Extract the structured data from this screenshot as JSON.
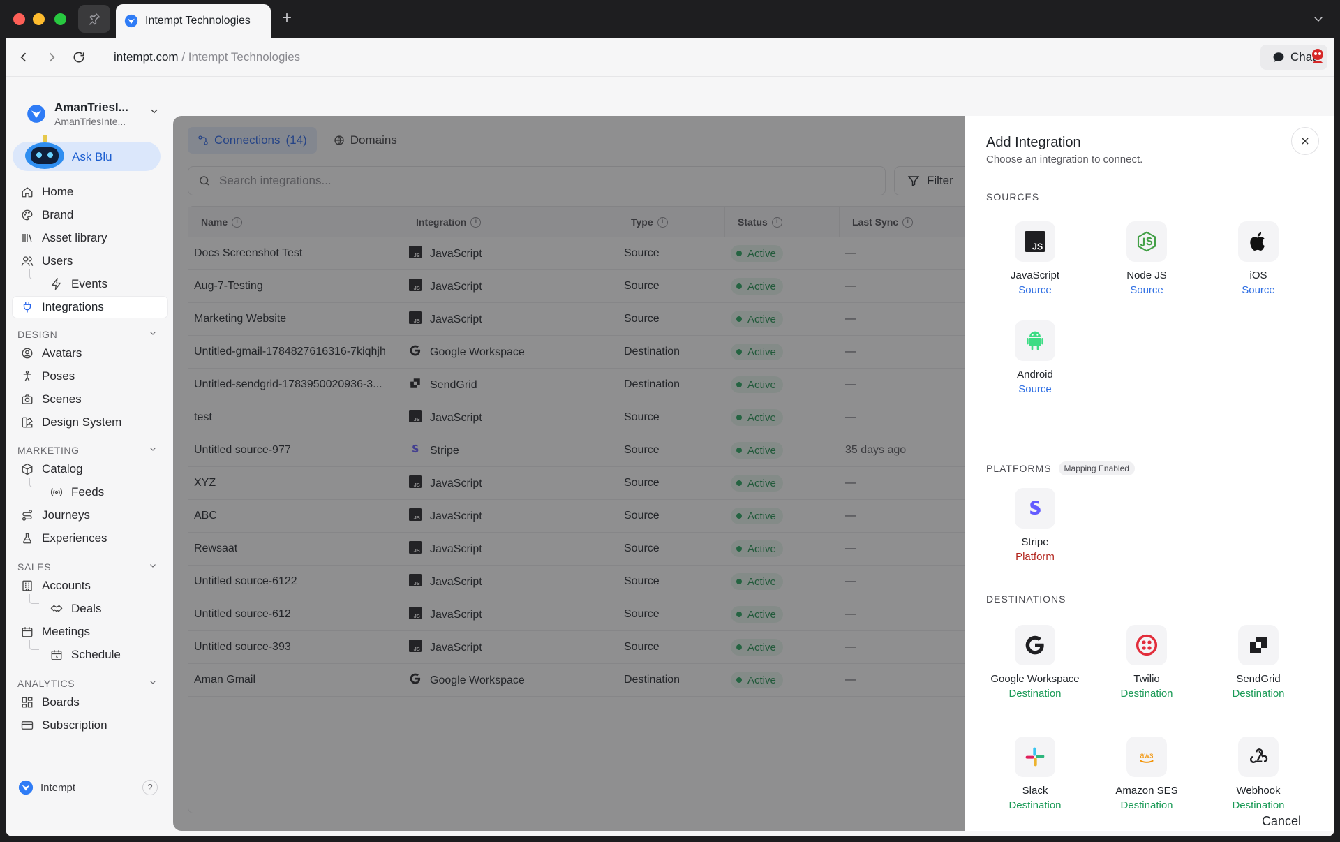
{
  "browser": {
    "tab_title": "Intempt Technologies",
    "url_domain": "intempt.com",
    "url_separator": "/",
    "url_page": "Intempt Technologies",
    "chat_label": "Chat"
  },
  "sidebar": {
    "workspace_name": "AmanTriesI...",
    "workspace_sub": "AmanTriesInte...",
    "ask_blu": "Ask Blu",
    "items": [
      {
        "label": "Home",
        "icon": "home-icon"
      },
      {
        "label": "Brand",
        "icon": "palette-icon"
      },
      {
        "label": "Asset library",
        "icon": "library-icon"
      },
      {
        "label": "Users",
        "icon": "users-icon"
      },
      {
        "label": "Events",
        "icon": "bolt-icon"
      },
      {
        "label": "Integrations",
        "icon": "plug-icon"
      }
    ],
    "sections": [
      {
        "title": "DESIGN",
        "items": [
          {
            "label": "Avatars",
            "icon": "avatar-icon"
          },
          {
            "label": "Poses",
            "icon": "pose-icon"
          },
          {
            "label": "Scenes",
            "icon": "camera-icon"
          },
          {
            "label": "Design System",
            "icon": "design-system-icon"
          }
        ]
      },
      {
        "title": "MARKETING",
        "items": [
          {
            "label": "Catalog",
            "icon": "box-icon"
          },
          {
            "label": "Feeds",
            "icon": "broadcast-icon"
          },
          {
            "label": "Journeys",
            "icon": "route-icon"
          },
          {
            "label": "Experiences",
            "icon": "flask-icon"
          }
        ]
      },
      {
        "title": "SALES",
        "items": [
          {
            "label": "Accounts",
            "icon": "building-icon"
          },
          {
            "label": "Deals",
            "icon": "handshake-icon"
          },
          {
            "label": "Meetings",
            "icon": "calendar-icon"
          },
          {
            "label": "Schedule",
            "icon": "calendar-clock-icon"
          }
        ]
      },
      {
        "title": "ANALYTICS",
        "items": [
          {
            "label": "Boards",
            "icon": "grid-icon"
          },
          {
            "label": "Subscription",
            "icon": "card-icon"
          }
        ]
      }
    ],
    "footer_brand": "Intempt",
    "footer_help": "?"
  },
  "main": {
    "tab_connections": "Connections",
    "tab_connections_count": "(14)",
    "tab_domains": "Domains",
    "search_placeholder": "Search integrations...",
    "filter_label": "Filter",
    "columns": [
      "Name",
      "Integration",
      "Type",
      "Status",
      "Last Sync"
    ],
    "rows": [
      {
        "name": "Docs Screenshot Test",
        "integration": "JavaScript",
        "icon": "js",
        "type": "Source",
        "status": "Active",
        "last_sync": "—"
      },
      {
        "name": "Aug-7-Testing",
        "integration": "JavaScript",
        "icon": "js",
        "type": "Source",
        "status": "Active",
        "last_sync": "—"
      },
      {
        "name": "Marketing Website",
        "integration": "JavaScript",
        "icon": "js",
        "type": "Source",
        "status": "Active",
        "last_sync": "—"
      },
      {
        "name": "Untitled-gmail-1784827616316-7kiqhjh",
        "integration": "Google Workspace",
        "icon": "google",
        "type": "Destination",
        "status": "Active",
        "last_sync": "—"
      },
      {
        "name": "Untitled-sendgrid-1783950020936-3...",
        "integration": "SendGrid",
        "icon": "sendgrid",
        "type": "Destination",
        "status": "Active",
        "last_sync": "—"
      },
      {
        "name": "test",
        "integration": "JavaScript",
        "icon": "js",
        "type": "Source",
        "status": "Active",
        "last_sync": "—"
      },
      {
        "name": "Untitled source-977",
        "integration": "Stripe",
        "icon": "stripe",
        "type": "Source",
        "status": "Active",
        "last_sync": "35 days ago"
      },
      {
        "name": "XYZ",
        "integration": "JavaScript",
        "icon": "js",
        "type": "Source",
        "status": "Active",
        "last_sync": "—"
      },
      {
        "name": "ABC",
        "integration": "JavaScript",
        "icon": "js",
        "type": "Source",
        "status": "Active",
        "last_sync": "—"
      },
      {
        "name": "Rewsaat",
        "integration": "JavaScript",
        "icon": "js",
        "type": "Source",
        "status": "Active",
        "last_sync": "—"
      },
      {
        "name": "Untitled source-6122",
        "integration": "JavaScript",
        "icon": "js",
        "type": "Source",
        "status": "Active",
        "last_sync": "—"
      },
      {
        "name": "Untitled source-612",
        "integration": "JavaScript",
        "icon": "js",
        "type": "Source",
        "status": "Active",
        "last_sync": "—"
      },
      {
        "name": "Untitled source-393",
        "integration": "JavaScript",
        "icon": "js",
        "type": "Source",
        "status": "Active",
        "last_sync": "—"
      },
      {
        "name": "Aman Gmail",
        "integration": "Google Workspace",
        "icon": "google",
        "type": "Destination",
        "status": "Active",
        "last_sync": "—"
      }
    ]
  },
  "drawer": {
    "title": "Add Integration",
    "subtitle": "Choose an integration to connect.",
    "sources_title": "SOURCES",
    "sources": [
      {
        "name": "JavaScript",
        "type": "Source",
        "icon": "js"
      },
      {
        "name": "Node JS",
        "type": "Source",
        "icon": "nodejs"
      },
      {
        "name": "iOS",
        "type": "Source",
        "icon": "apple"
      },
      {
        "name": "Android",
        "type": "Source",
        "icon": "android"
      }
    ],
    "platforms_title": "PLATFORMS",
    "platforms_chip": "Mapping Enabled",
    "platforms": [
      {
        "name": "Stripe",
        "type": "Platform",
        "icon": "stripe"
      }
    ],
    "destinations_title": "DESTINATIONS",
    "destinations": [
      {
        "name": "Google Workspace",
        "type": "Destination",
        "icon": "google"
      },
      {
        "name": "Twilio",
        "type": "Destination",
        "icon": "twilio"
      },
      {
        "name": "SendGrid",
        "type": "Destination",
        "icon": "sendgrid"
      },
      {
        "name": "Slack",
        "type": "Destination",
        "icon": "slack"
      },
      {
        "name": "Amazon SES",
        "type": "Destination",
        "icon": "aws"
      },
      {
        "name": "Webhook",
        "type": "Destination",
        "icon": "webhook"
      }
    ],
    "cancel_label": "Cancel"
  },
  "colors": {
    "accent": "#2563eb",
    "source": "#2f6fe3",
    "platform": "#b3261e",
    "destination": "#1a9a56",
    "active": "#22a55c"
  }
}
